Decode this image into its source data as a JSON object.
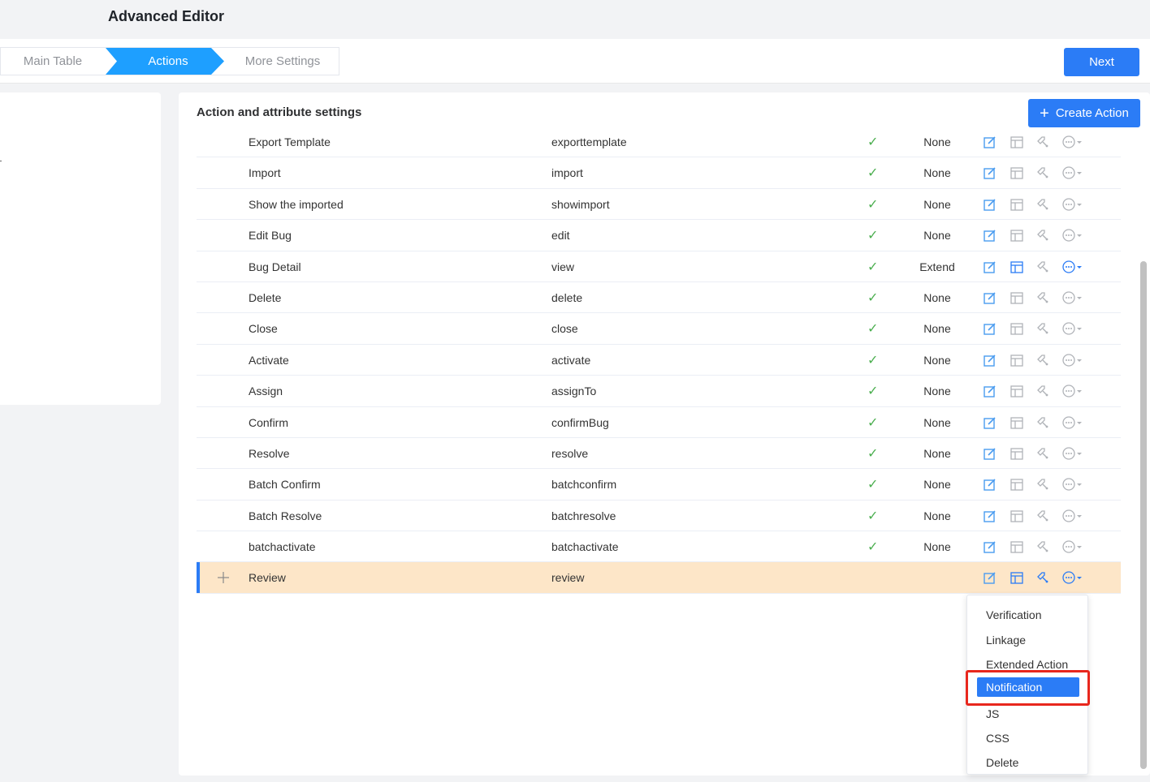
{
  "app": {
    "title": "Advanced Editor"
  },
  "steps": {
    "s1": "Main Table",
    "s2": "Actions",
    "s3": "More Settings"
  },
  "header": {
    "next_label": "Next"
  },
  "section": {
    "title": "Action and attribute settings",
    "create_label": "Create Action",
    "create_icon": "plus-icon"
  },
  "rows": [
    {
      "name": "Export Template",
      "code": "exporttemplate",
      "enabled": true,
      "extension": "None"
    },
    {
      "name": "Import",
      "code": "import",
      "enabled": true,
      "extension": "None"
    },
    {
      "name": "Show the imported",
      "code": "showimport",
      "enabled": true,
      "extension": "None"
    },
    {
      "name": "Edit Bug",
      "code": "edit",
      "enabled": true,
      "extension": "None"
    },
    {
      "name": "Bug Detail",
      "code": "view",
      "enabled": true,
      "extension": "Extend"
    },
    {
      "name": "Delete",
      "code": "delete",
      "enabled": true,
      "extension": "None"
    },
    {
      "name": "Close",
      "code": "close",
      "enabled": true,
      "extension": "None"
    },
    {
      "name": "Activate",
      "code": "activate",
      "enabled": true,
      "extension": "None"
    },
    {
      "name": "Assign",
      "code": "assignTo",
      "enabled": true,
      "extension": "None"
    },
    {
      "name": "Confirm",
      "code": "confirmBug",
      "enabled": true,
      "extension": "None"
    },
    {
      "name": "Resolve",
      "code": "resolve",
      "enabled": true,
      "extension": "None"
    },
    {
      "name": "Batch Confirm",
      "code": "batchconfirm",
      "enabled": true,
      "extension": "None"
    },
    {
      "name": "Batch Resolve",
      "code": "batchresolve",
      "enabled": true,
      "extension": "None"
    },
    {
      "name": "batchactivate",
      "code": "batchactivate",
      "enabled": true,
      "extension": "None"
    },
    {
      "name": "Review",
      "code": "review",
      "enabled": false,
      "extension": "",
      "selected": true
    }
  ],
  "dropdown": {
    "items": [
      "Verification",
      "Linkage",
      "Extended Action",
      "Notification",
      "JS",
      "CSS",
      "Delete"
    ],
    "active": "Notification"
  },
  "colors": {
    "accent": "#2b7cf6",
    "step_active": "#1e9fff",
    "selected_row": "#fde6c8",
    "check": "#4caf50",
    "highlight": "#e8271d"
  }
}
